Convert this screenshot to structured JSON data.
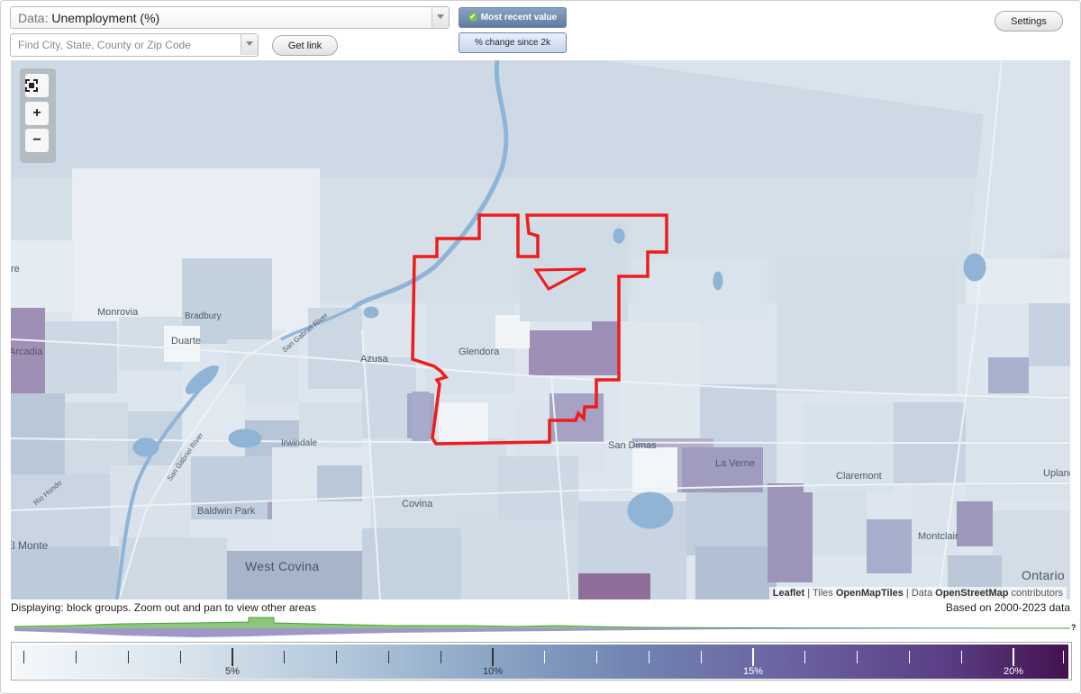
{
  "controls": {
    "data_prefix": "Data:",
    "data_value": "Unemployment (%)",
    "search_placeholder": "Find City, State, County or Zip Code",
    "get_link": "Get link",
    "mode_recent": "Most recent value",
    "mode_change": "% change since 2k",
    "settings": "Settings"
  },
  "map": {
    "zoom_in": "+",
    "zoom_out": "−",
    "places": [
      "Monrovia",
      "Bradbury",
      "Duarte",
      "Arcadia",
      "Azusa",
      "Glendora",
      "Irwindale",
      "San Dimas",
      "La Verne",
      "Claremont",
      "Upland",
      "Baldwin Park",
      "Covina",
      "El Monte",
      "West Covina",
      "Montclair",
      "Ontario",
      "San Gabriel River",
      "San Gabriel River",
      "Rio Hondo",
      "re"
    ],
    "attribution": {
      "leaflet": "Leaflet",
      "tiles_prefix": "Tiles",
      "tiles": "OpenMapTiles",
      "data_prefix": "Data",
      "data": "OpenStreetMap",
      "suffix": "contributors"
    },
    "colors": {
      "highlight": "#ee1c1c",
      "water": "#8fb4d6"
    }
  },
  "status": {
    "displaying": "Displaying: block groups. Zoom out and pan to view other areas",
    "based_on": "Based on 2000-2023 data",
    "hist_help": "?"
  },
  "legend": {
    "labels": [
      "5%",
      "10%",
      "15%",
      "20%"
    ]
  }
}
